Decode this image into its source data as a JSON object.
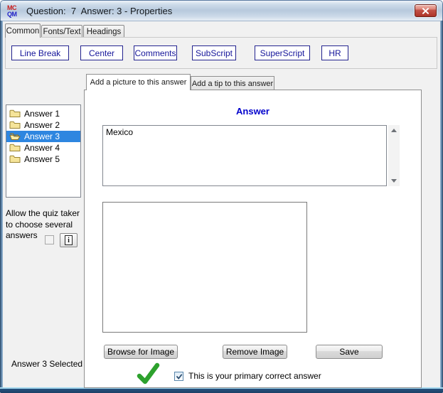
{
  "window": {
    "title": "Question:  7  Answer: 3 - Properties",
    "icon_text_top": "MC",
    "icon_text_bottom": "QM"
  },
  "outer_tabs": [
    "Common",
    "Fonts/Text",
    "Headings"
  ],
  "outer_tabs_selected": "Common",
  "toolbar_buttons": [
    "Line Break",
    "Center",
    "Comments",
    "SubScript",
    "SuperScript",
    "HR"
  ],
  "answers_list": {
    "items": [
      "Answer 1",
      "Answer 2",
      "Answer 3",
      "Answer 4",
      "Answer 5"
    ],
    "selected": "Answer 3"
  },
  "left_panel": {
    "allow_checkbox_label": "Allow the quiz taker to choose several answers",
    "allow_checkbox_checked": false,
    "status_text": "Answer 3 Selected"
  },
  "inner_tabs": [
    "Add a picture to this answer",
    "Add a tip to this answer"
  ],
  "inner_tabs_selected": "Add a picture to this answer",
  "answer_editor": {
    "heading": "Answer",
    "text": "Mexico"
  },
  "image_buttons": {
    "browse": "Browse for Image",
    "remove": "Remove Image",
    "save": "Save"
  },
  "primary_answer": {
    "label": "This is your primary correct answer",
    "checked": true
  },
  "icons": {
    "app": "mcqm-logo",
    "close": "window-close-x",
    "folder_closed": "yellow-folder",
    "folder_open": "yellow-open-folder",
    "info": "boxed-i",
    "scroll_up": "triangle-up",
    "scroll_down": "triangle-down",
    "big_check": "green-checkmark",
    "checkbox_check": "blue-check"
  },
  "colors": {
    "toolbar_blue": "#15159a",
    "heading_blue": "#0000cc",
    "selection_blue": "#2e86e0",
    "check_green": "#2da12d",
    "window_border_blue": "#27517f",
    "close_button_red": "#c4544a"
  }
}
